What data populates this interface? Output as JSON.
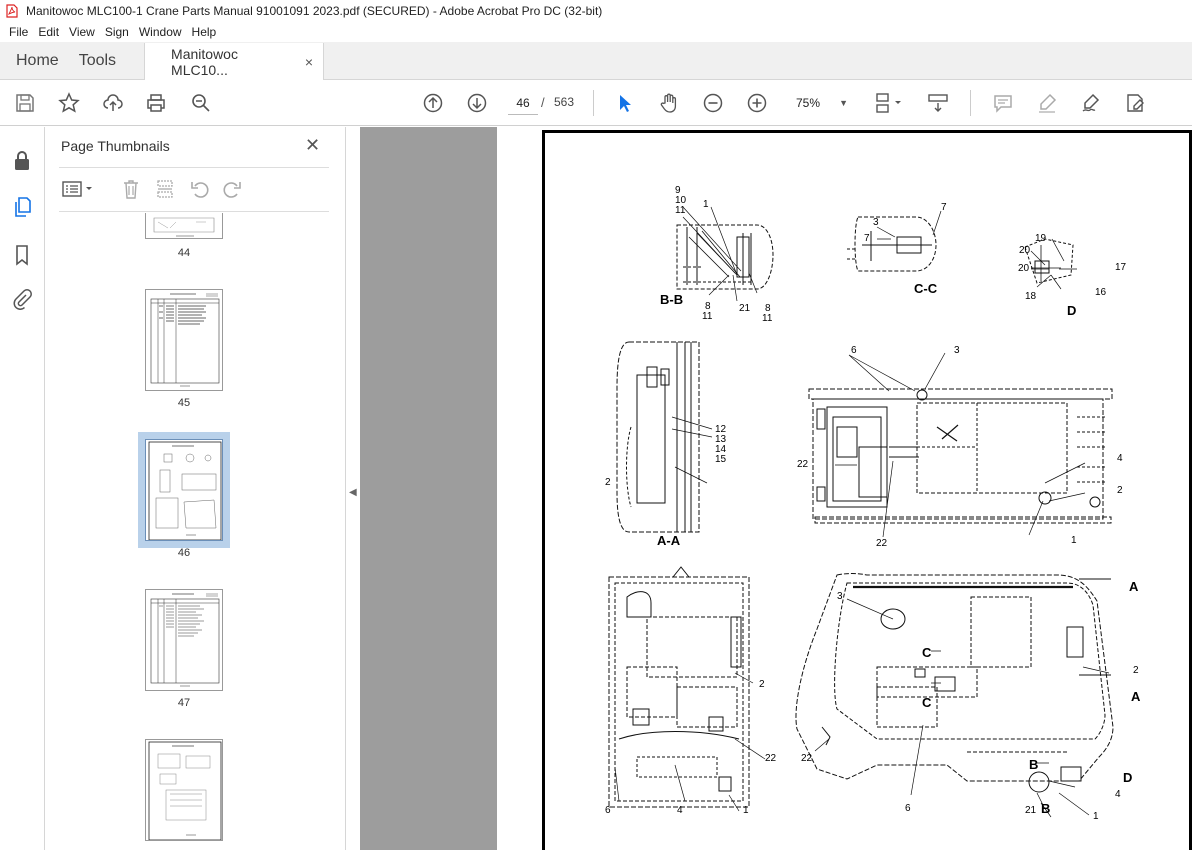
{
  "window": {
    "title": "Manitowoc MLC100-1 Crane Parts Manual 91001091 2023.pdf (SECURED) - Adobe Acrobat Pro DC (32-bit)"
  },
  "menu": [
    "File",
    "Edit",
    "View",
    "Sign",
    "Window",
    "Help"
  ],
  "tabs": {
    "home": "Home",
    "tools": "Tools",
    "document": "Manitowoc MLC10...",
    "close": "×"
  },
  "toolbar": {
    "page_current": "46",
    "page_sep": "/",
    "page_total": "563",
    "zoom": "75%"
  },
  "panel": {
    "title": "Page Thumbnails",
    "close": "✕"
  },
  "thumbnails": [
    {
      "num": "44"
    },
    {
      "num": "45"
    },
    {
      "num": "46"
    },
    {
      "num": "47"
    },
    {
      "num": ""
    }
  ],
  "drawing": {
    "sections": [
      "B-B",
      "C-C",
      "D",
      "A-A"
    ],
    "arrows": [
      "A",
      "A",
      "C",
      "C",
      "B",
      "B",
      "D"
    ],
    "callouts_bb": [
      "9",
      "10",
      "11",
      "1",
      "8",
      "11",
      "21",
      "8",
      "11"
    ],
    "callouts_cc": [
      "3",
      "7",
      "7"
    ],
    "callouts_d": [
      "19",
      "20",
      "20",
      "17",
      "18",
      "16"
    ],
    "callouts_aa": [
      "12",
      "13",
      "14",
      "15",
      "2"
    ],
    "callouts_top": [
      "6",
      "3",
      "22",
      "4",
      "2",
      "22",
      "1"
    ],
    "callouts_left": [
      "2",
      "22",
      "6",
      "4",
      "1"
    ],
    "callouts_iso": [
      "3",
      "2",
      "22",
      "6",
      "4",
      "21",
      "1"
    ]
  },
  "colors": {
    "accent": "#1473e6",
    "selected_thumb": "#b9d1ea",
    "doc_bg": "#9d9d9d"
  }
}
